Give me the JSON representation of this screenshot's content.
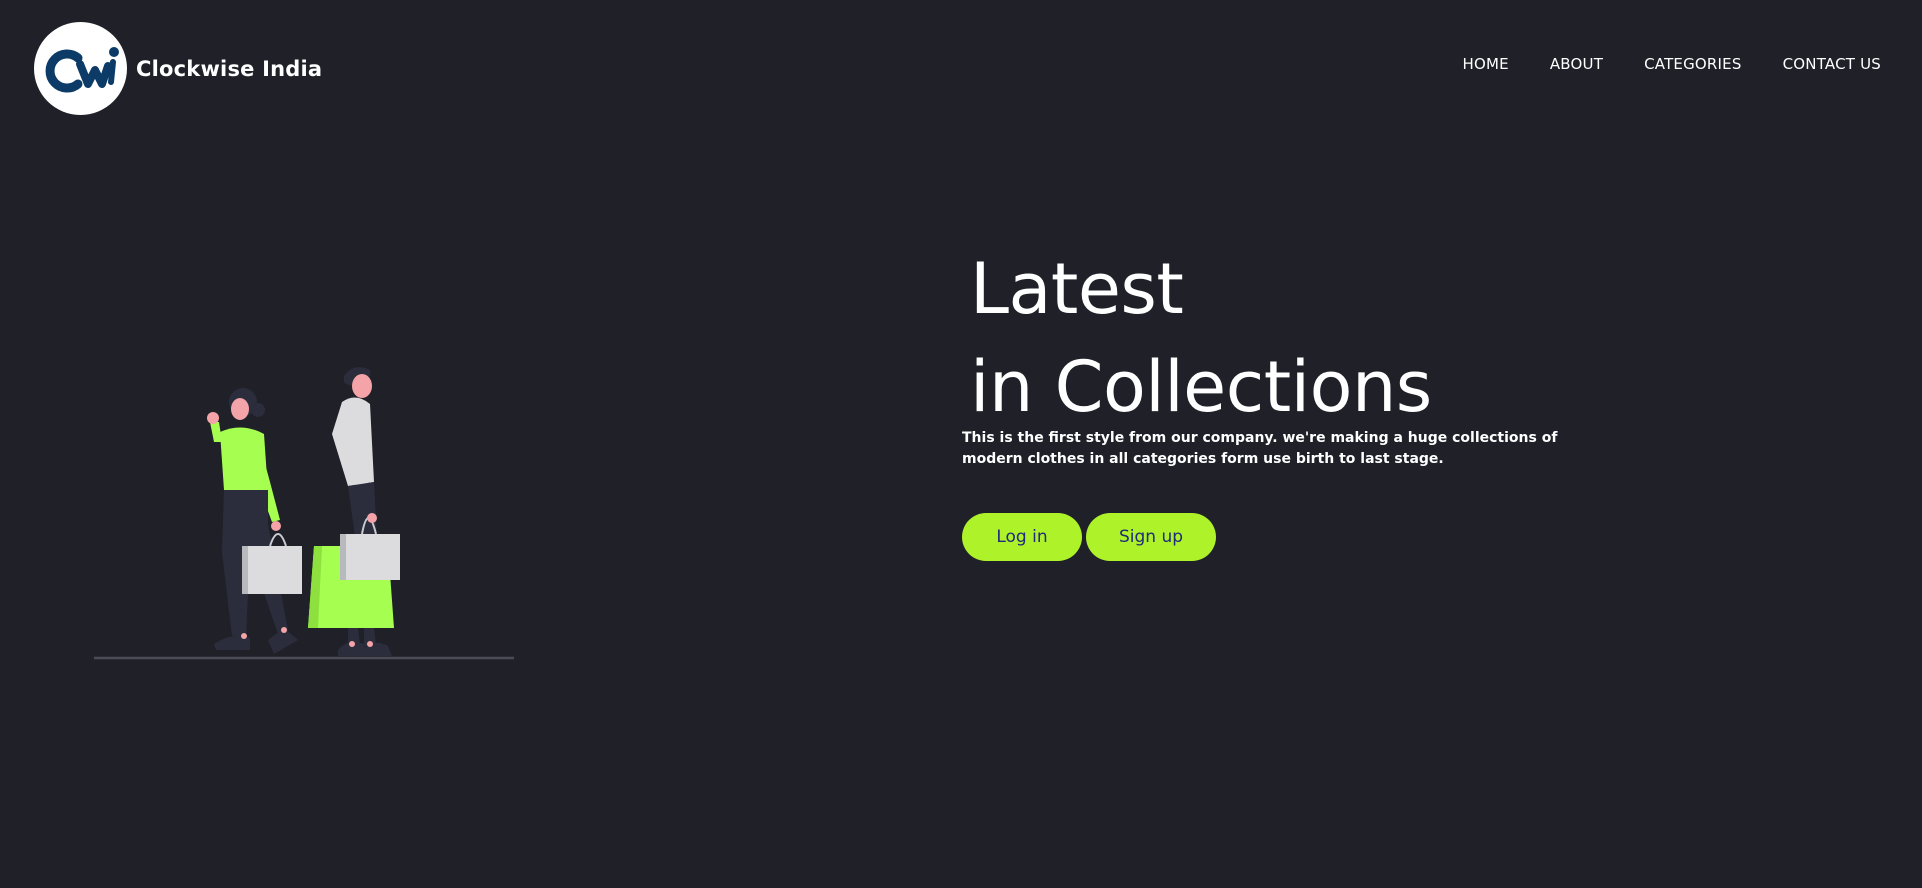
{
  "brand": {
    "name": "Clockwise India",
    "logo_icon": "cwi-logo-icon"
  },
  "nav": {
    "items": [
      {
        "label": "HOME"
      },
      {
        "label": "ABOUT"
      },
      {
        "label": "CATEGORIES"
      },
      {
        "label": "CONTACT US"
      }
    ]
  },
  "hero": {
    "title_line1": "Latest",
    "title_line2": "in Collections",
    "description": "This is the first style from our company. we're making a huge collections of modern clothes in all categories form use birth to last stage.",
    "login_label": "Log in",
    "signup_label": "Sign up",
    "illustration": "shopping-couple-illustration"
  },
  "colors": {
    "background": "#1f2028",
    "accent": "#aef22a",
    "button_text": "#1f2a7a",
    "logo_blue": "#0b3b66"
  }
}
